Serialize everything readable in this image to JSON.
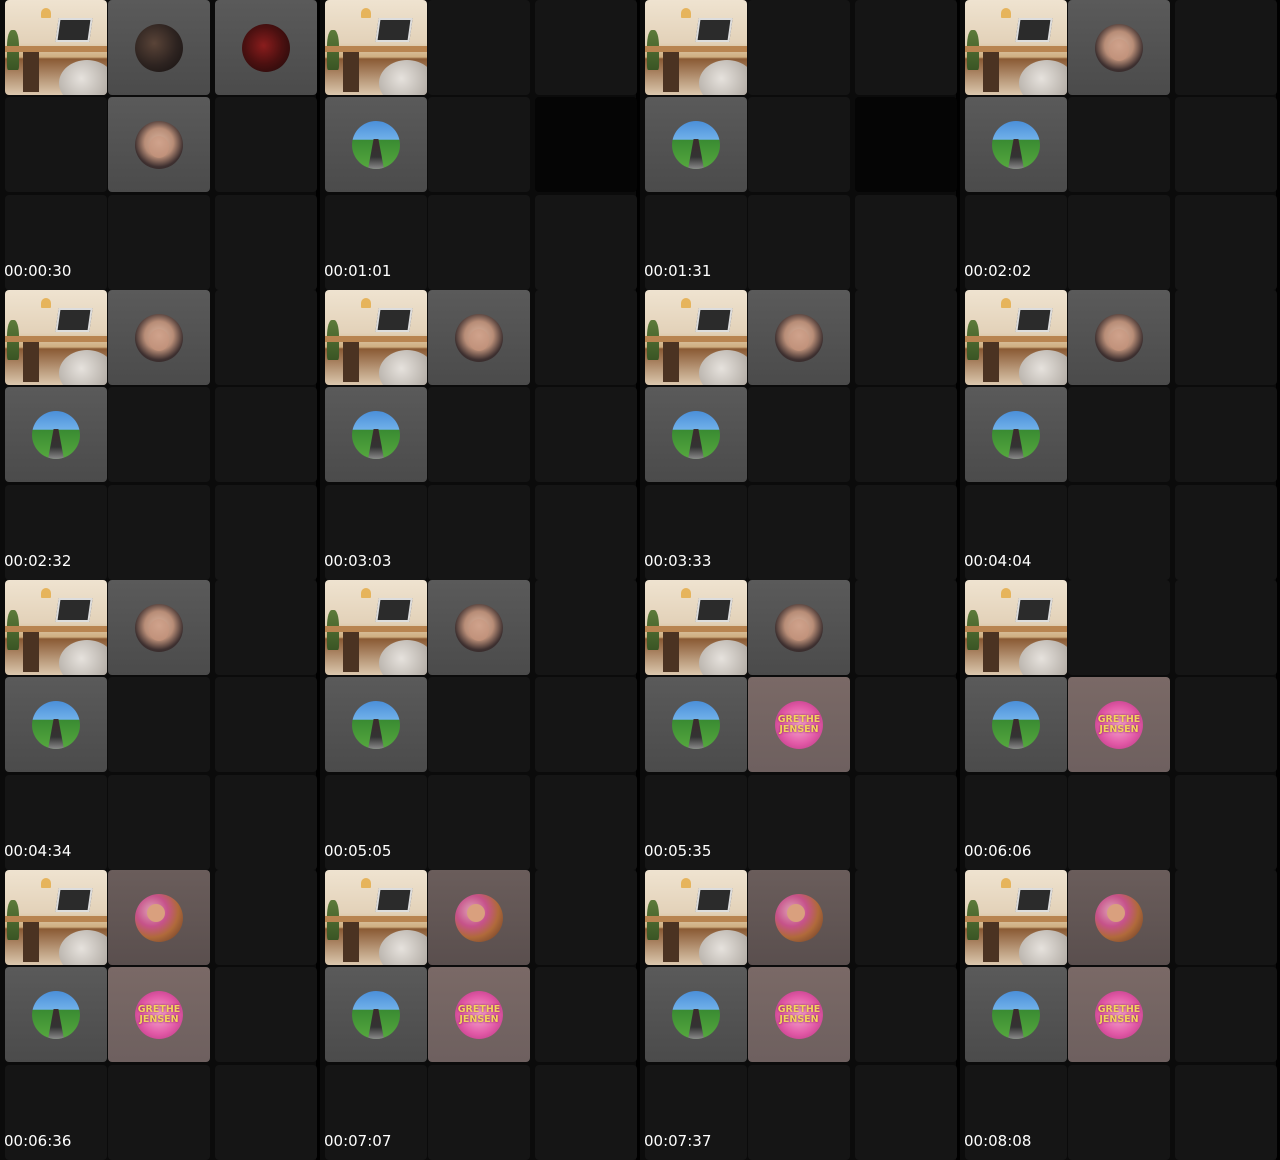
{
  "timestamps": [
    "00:00:30",
    "00:01:01",
    "00:01:31",
    "00:02:02",
    "00:02:32",
    "00:03:03",
    "00:03:33",
    "00:04:04",
    "00:04:34",
    "00:05:05",
    "00:05:35",
    "00:06:06",
    "00:06:36",
    "00:07:07",
    "00:07:37",
    "00:08:08"
  ],
  "badge": {
    "line1": "GRETHE",
    "line2": "JENSEN"
  }
}
